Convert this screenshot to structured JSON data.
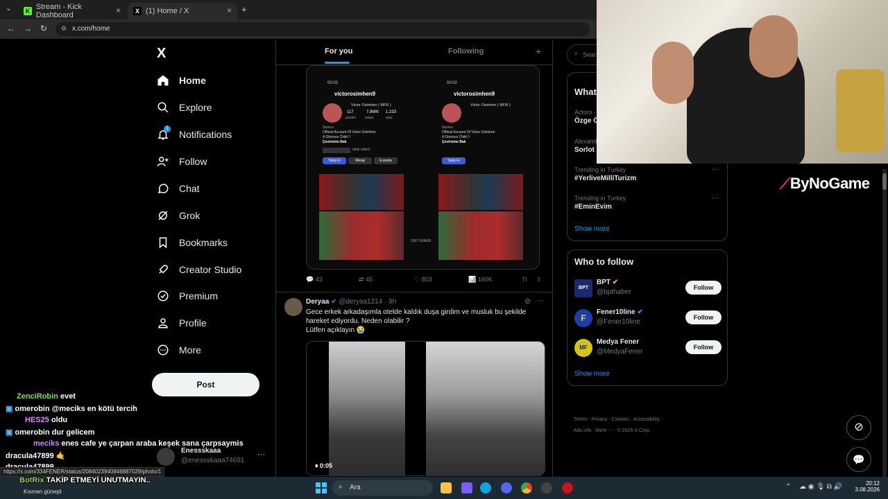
{
  "browser": {
    "tabs": [
      {
        "label": "Stream - Kick Dashboard",
        "favicon": "K"
      },
      {
        "label": "(1) Home / X",
        "favicon": "X"
      }
    ],
    "url": "x.com/home"
  },
  "nav": {
    "logo": "X",
    "items": [
      {
        "label": "Home",
        "icon": "home-icon"
      },
      {
        "label": "Explore",
        "icon": "search-icon"
      },
      {
        "label": "Notifications",
        "icon": "bell-icon",
        "badge": "1"
      },
      {
        "label": "Follow",
        "icon": "person-plus-icon"
      },
      {
        "label": "Chat",
        "icon": "chat-icon"
      },
      {
        "label": "Grok",
        "icon": "grok-icon"
      },
      {
        "label": "Bookmarks",
        "icon": "bookmark-icon"
      },
      {
        "label": "Creator Studio",
        "icon": "rocket-icon"
      },
      {
        "label": "Premium",
        "icon": "verified-icon"
      },
      {
        "label": "Profile",
        "icon": "user-icon"
      },
      {
        "label": "More",
        "icon": "more-circle-icon"
      }
    ],
    "post_label": "Post",
    "account": {
      "name": "Enessskaaa",
      "handle": "@enessskaaa74691"
    }
  },
  "timeline": {
    "tabs": [
      "For you",
      "Following"
    ],
    "post1": {
      "profile_name": "victorosimhen9",
      "profile_full": "Victor Osimhen ( MFR )",
      "stats": [
        [
          "117",
          "gönderi"
        ],
        [
          "7,8MN",
          "takipçi"
        ],
        [
          "1.233",
          "takip"
        ]
      ],
      "bio": [
        "Sporcu",
        "Official Account Of Victor Osimhen",
        "A Glorious Child !!",
        "Çevirisine Bak"
      ],
      "followed_by": "takip ediyor",
      "buttons": [
        "Takip Et",
        "Mesaj",
        "E-posta"
      ],
      "time": "00:02",
      "watermark": "1907 FENER",
      "actions": {
        "replies": "43",
        "reposts": "45",
        "likes": "803",
        "views": "160K"
      }
    },
    "post2": {
      "name": "Deryaa",
      "handle": "@deryaa1214",
      "time": "· 9h",
      "text": "Gece erkek arkadaşımla otelde kaldık duşa girdim ve musluk bu şekilde hareket ediyordu. Neden olabilir ?",
      "text2": "Lütfen açıklayın 😭",
      "video_time": "0:05"
    }
  },
  "right": {
    "search_placeholder": "Sear",
    "whats_happening": "What",
    "trends": [
      {
        "meta": "Actors ·",
        "topic": "Özge Ö"
      },
      {
        "meta": "Alexand",
        "topic": "Sorlot"
      },
      {
        "meta": "Trending in Turkey",
        "topic": "#YerliveMilliTurizm"
      },
      {
        "meta": "Trending in Turkey",
        "topic": "#EminEvim"
      }
    ],
    "show_more": "Show more",
    "who_to_follow": "Who to follow",
    "follow_suggestions": [
      {
        "name": "BPT",
        "handle": "@bpthaber",
        "avatar": "BPT",
        "color": "#1a2a6c"
      },
      {
        "name": "Fener10line",
        "handle": "@Fener10line",
        "avatar": "F",
        "color": "#1d3ea8"
      },
      {
        "name": "Medya Fener",
        "handle": "@MedyaFener",
        "avatar": "MF",
        "color": "#d6c21a"
      }
    ],
    "follow_label": "Follow",
    "show_more2": "Show more",
    "footer": [
      "Terms",
      "Privacy",
      "Cookies",
      "Accessibility",
      "Ads info",
      "More ···",
      "© 2026 X Corp."
    ]
  },
  "brand_watermark": "ByNoGame",
  "chat": [
    {
      "user": "ZenciRobin",
      "msg": "evet",
      "color": "#7ee04a"
    },
    {
      "user": "omerobin",
      "msg": "@meciks en kötü tercih",
      "color": "#ffffff"
    },
    {
      "user": "HES25",
      "msg": "oldu",
      "color": "#e58cff"
    },
    {
      "user": "omerobin",
      "msg": "dur gelicem",
      "color": "#ffffff"
    },
    {
      "user": "meciks",
      "msg": "enes cafe ye çarpan araba keşek sana çarpsaymis",
      "color": "#c58cff"
    },
    {
      "user": "dracula47899",
      "msg": "🤙",
      "color": "#ffffff"
    },
    {
      "user": "dracula47899",
      "msg": "",
      "color": "#ffffff"
    },
    {
      "user": "BotRix",
      "msg": "TAKİP ETMEYİ UNUTMAYIN..",
      "color": "#7ee04a"
    }
  ],
  "status_url": "https://x.com/334FENER/status/2084023940846887029/photo/1",
  "taskbar": {
    "weather": "Kısmen güneşli",
    "search": "Ara",
    "time": "20:12",
    "date": "3.08.2026"
  }
}
